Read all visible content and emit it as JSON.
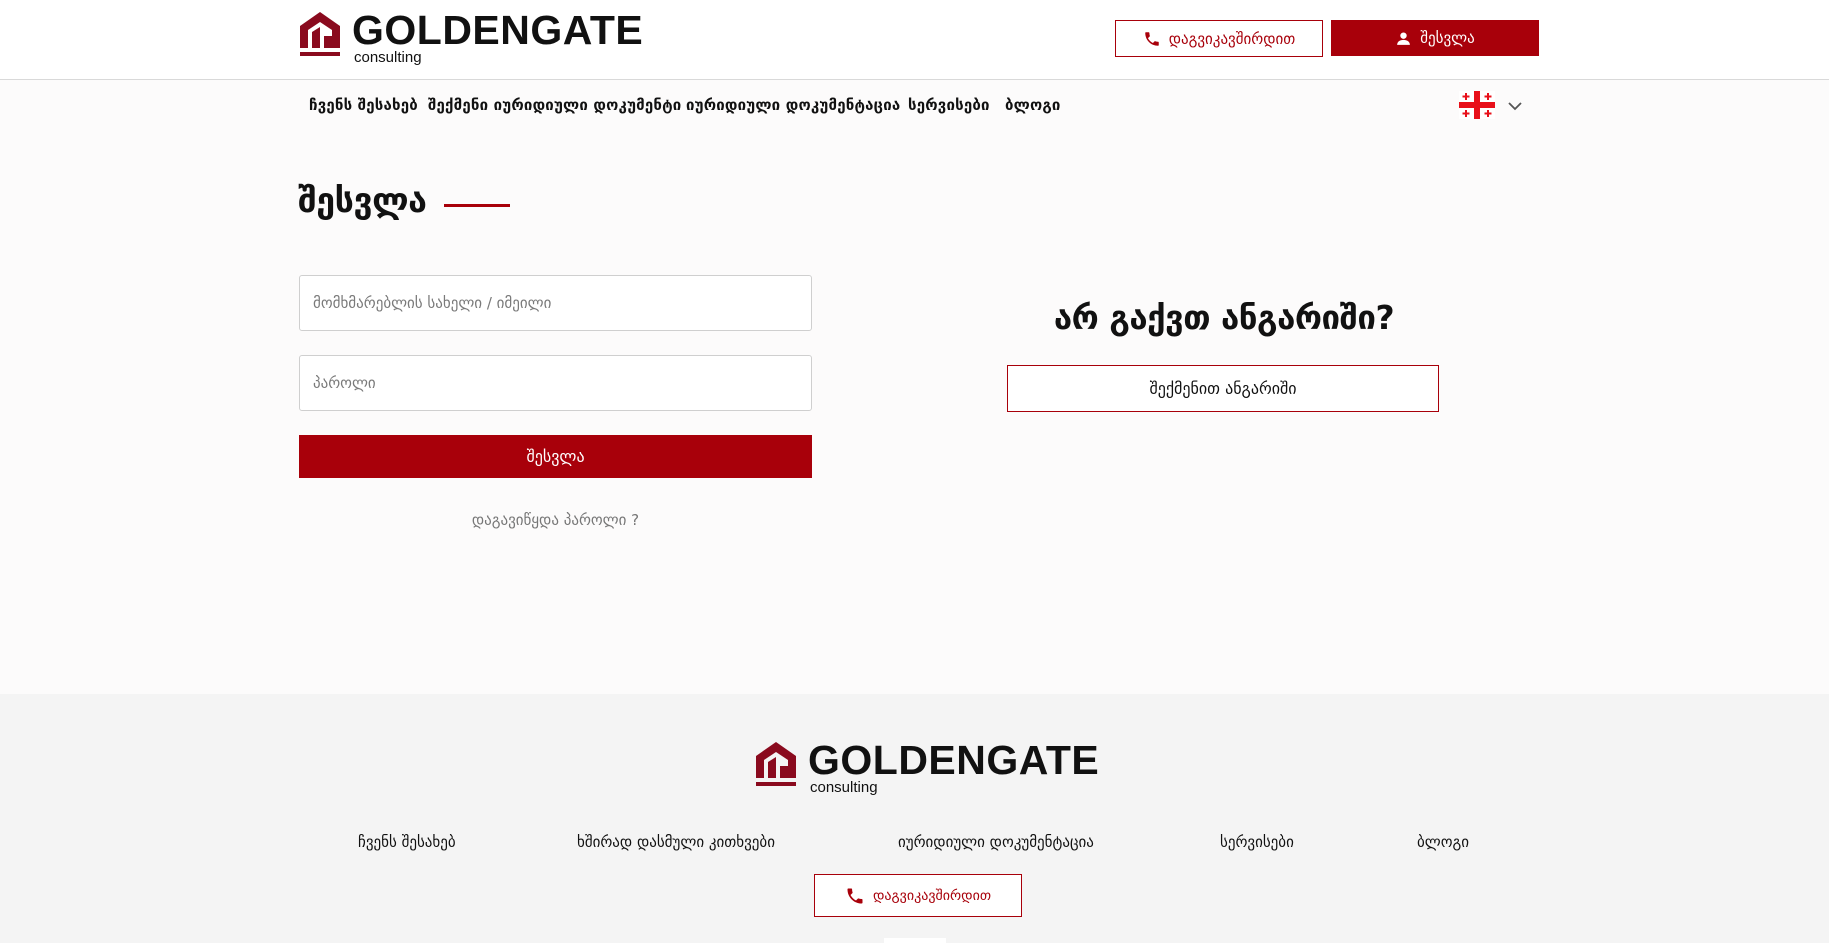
{
  "header": {
    "logo": {
      "brand": "GOLDENGATE",
      "sub": "consulting"
    },
    "contact_label": "დაგვიკავშირდით",
    "login_label": "შესვლა"
  },
  "nav": {
    "items": [
      "ჩვენს შესახებ",
      "შექმენი იურიდიული დოკუმენტი",
      "იურიდიული დოკუმენტაცია",
      "სერვისები",
      "ბლოგი"
    ],
    "language_icon": "georgian-flag-icon"
  },
  "login": {
    "title": "შესვლა",
    "username_placeholder": "მომხმარებლის სახელი / იმეილი",
    "password_placeholder": "პაროლი",
    "submit_label": "შესვლა",
    "forgot_label": "დაგავიწყდა პაროლი ?"
  },
  "register": {
    "heading": "არ გაქვთ ანგარიში?",
    "button_label": "შექმენით ანგარიში"
  },
  "footer": {
    "logo": {
      "brand": "GOLDENGATE",
      "sub": "consulting"
    },
    "links": [
      "ჩვენს შესახებ",
      "ხშირად დასმული კითხვები",
      "იურიდიული დოკუმენტაცია",
      "სერვისები",
      "ბლოგი"
    ],
    "contact_label": "დაგვიკავშირდით"
  },
  "colors": {
    "accent": "#a8000a",
    "footer_bg": "#f4f4f4",
    "page_bg": "#fcfbfb"
  }
}
